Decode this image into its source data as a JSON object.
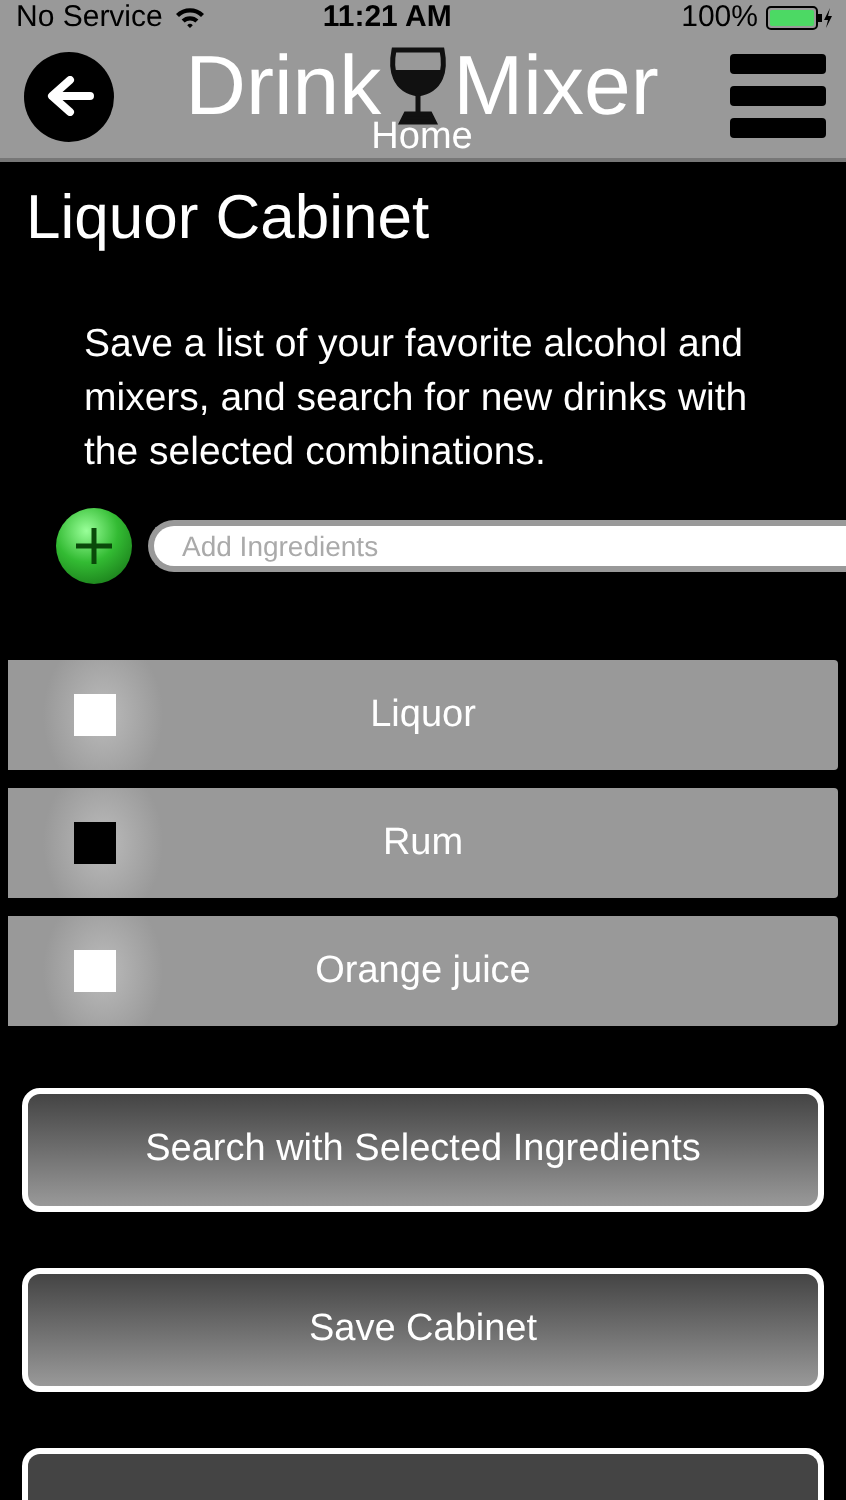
{
  "status_bar": {
    "carrier": "No Service",
    "time": "11:21 AM",
    "battery": "100%"
  },
  "header": {
    "title_left": "Drink",
    "title_right": "Mixer",
    "subtitle": "Home"
  },
  "page": {
    "title": "Liquor Cabinet",
    "description": "Save a list of your favorite alcohol and mixers, and search for new drinks with the selected combinations."
  },
  "add_field": {
    "placeholder": "Add Ingredients"
  },
  "ingredients": [
    {
      "label": "Liquor",
      "checked": false
    },
    {
      "label": "Rum",
      "checked": true
    },
    {
      "label": "Orange juice",
      "checked": false
    }
  ],
  "buttons": [
    "Search with Selected Ingredients",
    "Save Cabinet"
  ]
}
